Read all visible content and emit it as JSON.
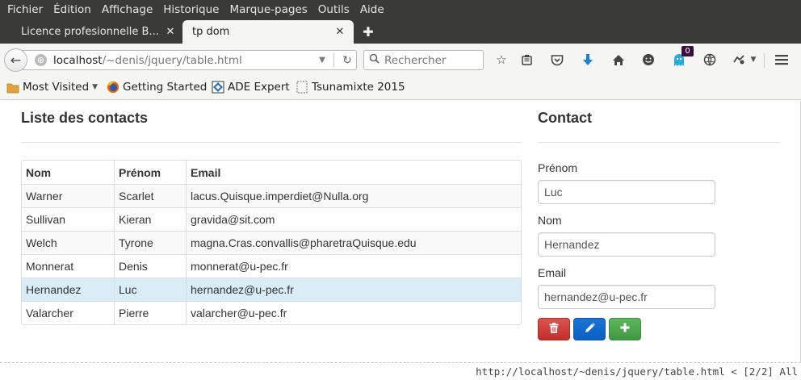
{
  "menu": [
    "Fichier",
    "Édition",
    "Affichage",
    "Historique",
    "Marque-pages",
    "Outils",
    "Aide"
  ],
  "tabs": [
    {
      "title": "Licence profesionnelle B...",
      "active": false
    },
    {
      "title": "tp dom",
      "active": true
    }
  ],
  "toolbar": {
    "url_host": "localhost",
    "url_path": "/~denis/jquery/table.html",
    "search_placeholder": "Rechercher",
    "badge_count": "0"
  },
  "bookmarks": [
    {
      "label": "Most Visited",
      "icon": "bookmark-folder-icon",
      "dropdown": true
    },
    {
      "label": "Getting Started",
      "icon": "firefox-icon"
    },
    {
      "label": "ADE Expert",
      "icon": "ade-icon"
    },
    {
      "label": "Tsunamixte 2015",
      "icon": "page-icon"
    }
  ],
  "page": {
    "list_title": "Liste des contacts",
    "contact_title": "Contact",
    "columns": [
      "Nom",
      "Prénom",
      "Email"
    ],
    "rows": [
      {
        "nom": "Warner",
        "prenom": "Scarlet",
        "email": "lacus.Quisque.imperdiet@Nulla.org"
      },
      {
        "nom": "Sullivan",
        "prenom": "Kieran",
        "email": "gravida@sit.com"
      },
      {
        "nom": "Welch",
        "prenom": "Tyrone",
        "email": "magna.Cras.convallis@pharetraQuisque.edu"
      },
      {
        "nom": "Monnerat",
        "prenom": "Denis",
        "email": "monnerat@u-pec.fr"
      },
      {
        "nom": "Hernandez",
        "prenom": "Luc",
        "email": "hernandez@u-pec.fr"
      },
      {
        "nom": "Valarcher",
        "prenom": "Pierre",
        "email": "valarcher@u-pec.fr"
      }
    ],
    "selected_row": 4,
    "form": {
      "prenom_label": "Prénom",
      "prenom_value": "Luc",
      "nom_label": "Nom",
      "nom_value": "Hernandez",
      "email_label": "Email",
      "email_value": "hernandez@u-pec.fr"
    }
  },
  "status": {
    "text": "http://localhost/~denis/jquery/table.html < [2/2] All"
  },
  "colors": {
    "selected_row": "#d9edf7",
    "delete": "#d9534f",
    "edit": "#0a5fc2",
    "add": "#5cb85c"
  }
}
